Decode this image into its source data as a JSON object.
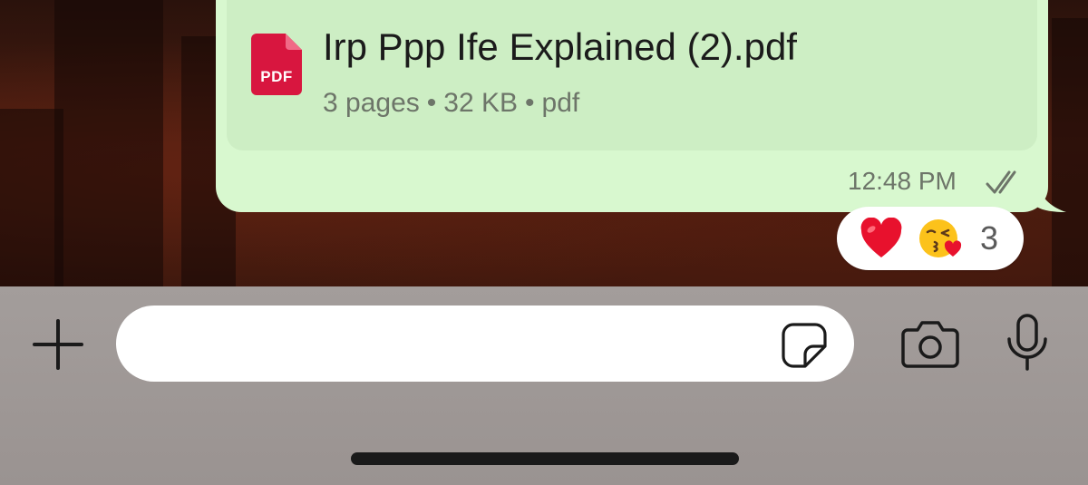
{
  "message": {
    "document": {
      "icon": "pdf-file-icon",
      "icon_label": "PDF",
      "icon_color": "#d8163f",
      "file_name": "Irp Ppp Ife Explained (2).pdf",
      "pages": "3 pages",
      "size": "32 KB",
      "type": "pdf",
      "separator": "•"
    },
    "time": "12:48 PM",
    "status_icon": "double-check-icon",
    "bubble_color": "#d8f8cf"
  },
  "reactions": {
    "emojis": [
      "heart",
      "kissing-face-with-heart"
    ],
    "count": "3"
  },
  "input_bar": {
    "plus_icon": "plus-icon",
    "placeholder": "",
    "sticker_icon": "sticker-icon",
    "camera_icon": "camera-icon",
    "mic_icon": "microphone-icon"
  }
}
